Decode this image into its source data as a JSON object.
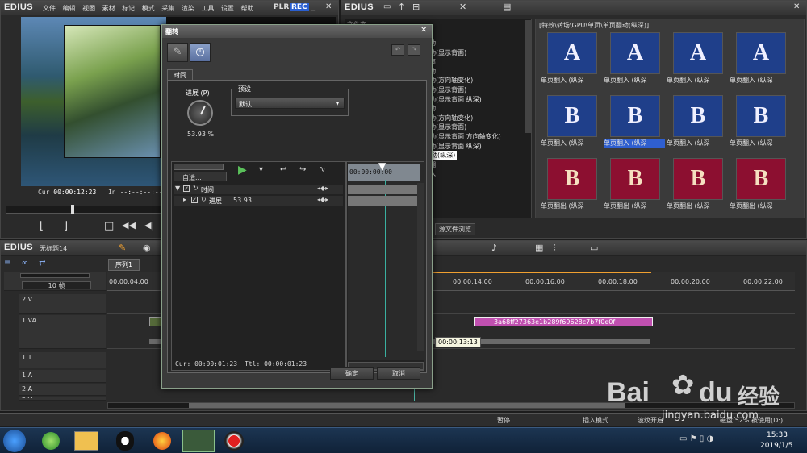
{
  "preview": {
    "logo": "EDIUS",
    "menu": [
      "文件",
      "编辑",
      "视图",
      "素材",
      "标记",
      "模式",
      "采集",
      "渲染",
      "工具",
      "设置",
      "帮助"
    ],
    "mode_plr": "PLR",
    "mode_rec": "REC",
    "cur_label": "Cur",
    "cur_value": "00:00:12:23",
    "in_label": "In",
    "in_value": "--:--:--:--"
  },
  "bin": {
    "logo": "EDIUS",
    "folder_header": "文件夹",
    "path": "[特效\\转场\\GPU\\单页\\单页翻动(纵深)]",
    "tree_items": [
      "动",
      "动(显示背面)",
      "离",
      "动",
      "动(方向轴变化)",
      "动(显示背面)",
      "动(显示背面 纵深)",
      "动",
      "动(方向轴变化)",
      "动(显示背面)",
      "动(显示背面 方向轴变化)",
      "动(显示背面 纵深)",
      "动(纵深)",
      "翻",
      "入"
    ],
    "source_tab": "源文件浏览",
    "effects": [
      {
        "letter": "A",
        "label": "单页翻入 (纵深"
      },
      {
        "letter": "A",
        "label": "单页翻入 (纵深"
      },
      {
        "letter": "A",
        "label": "单页翻入 (纵深"
      },
      {
        "letter": "A",
        "label": "单页翻入 (纵深"
      },
      {
        "letter": "B",
        "label": "单页翻入 (纵深"
      },
      {
        "letter": "B",
        "label": "单页翻入 (纵深"
      },
      {
        "letter": "B",
        "label": "单页翻入 (纵深"
      },
      {
        "letter": "B",
        "label": "单页翻入 (纵深"
      },
      {
        "letter": "B",
        "label": "单页翻出 (纵深"
      },
      {
        "letter": "B",
        "label": "单页翻出 (纵深"
      },
      {
        "letter": "B",
        "label": "单页翻出 (纵深"
      },
      {
        "letter": "B",
        "label": "单页翻出 (纵深"
      }
    ],
    "colors": {
      "tile_blue": "#1f3f8a",
      "tile_red": "#8c0f30",
      "selected": "#2f5fd0"
    }
  },
  "timeline": {
    "logo": "EDIUS",
    "project_name": "无标题14",
    "sequence_tab": "序列1",
    "zoom_label": "10 帧",
    "ruler_ticks": [
      "00:00:04:00",
      "00:00:14:00",
      "00:00:16:00",
      "00:00:18:00",
      "00:00:20:00",
      "00:00:22:00"
    ],
    "tracks": [
      "2 V",
      "1 VA",
      "1 T",
      "1 A",
      "2 A",
      "3 A"
    ],
    "clip_name": "3a68ff27363e1b289f69628c7b7f0e0f",
    "tooltip_time": "00:00:13:13",
    "colors": {
      "clip_pink": "#c050b0",
      "clip_blue": "#3060a0"
    }
  },
  "dialog": {
    "title": "翻转",
    "tab_time": "时间",
    "progress_label": "进展 (P)",
    "progress_value": "53.93 %",
    "preset_label": "预设",
    "preset_value": "默认",
    "auto_label": "自适...",
    "tree_time": "时间",
    "tree_progress": "进展",
    "tree_progress_value": "53.93",
    "tl_time": "00:00:00:00",
    "cur_readout": "Cur: 00:00:01:23",
    "ttl_readout": "Ttl: 00:00:01:23",
    "ok_label": "确定",
    "cancel_label": "取消"
  },
  "statusbar": {
    "pause": "暂停",
    "insert_mode": "插入模式",
    "ripple": "波纹开启",
    "disk": "磁盘:52% 被使用(D:)"
  },
  "taskbar": {
    "time": "15:33",
    "date": "2019/1/5"
  },
  "watermark": {
    "brand": "Bai",
    "brand2": "du",
    "brand3": "经验",
    "url": "jingyan.baidu.com"
  }
}
